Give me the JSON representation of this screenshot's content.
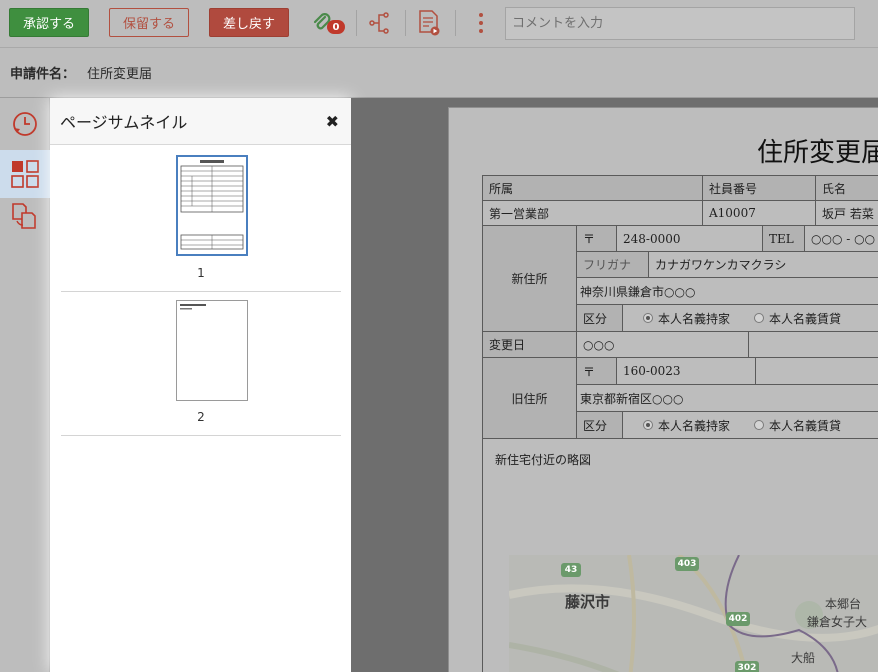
{
  "toolbar": {
    "approve_label": "承認する",
    "hold_label": "保留する",
    "return_label": "差し戻す",
    "attachment_count": "0",
    "comment_placeholder": "コメントを入力"
  },
  "subject": {
    "label": "申請件名：",
    "value": "住所変更届"
  },
  "leftnav": {
    "items": [
      "history-icon",
      "thumbnails-icon",
      "copy-icon"
    ]
  },
  "thumbnails": {
    "title": "ページサムネイル",
    "close": "✖",
    "pages": [
      {
        "number": "1"
      },
      {
        "number": "2"
      }
    ]
  },
  "document": {
    "title": "住所変更届",
    "header": {
      "dept_label": "所属",
      "empno_label": "社員番号",
      "name_label": "氏名"
    },
    "row1": {
      "dept": "第一営業部",
      "empno": "A10007",
      "name": "坂戸 若菜"
    },
    "new_address": {
      "label": "新住所",
      "zip_mark": "〒",
      "zip": "248-0000",
      "tel_label": "TEL",
      "tel": "○○○ - ○○",
      "furigana_label": "フリガナ",
      "furigana": "カナガワケンカマクラシ",
      "address": "神奈川県鎌倉市○○○",
      "kubun_label": "区分",
      "option1": "本人名義持家",
      "option2": "本人名義賃貸"
    },
    "change_date": {
      "label": "変更日",
      "value": "○○○"
    },
    "old_address": {
      "label": "旧住所",
      "zip_mark": "〒",
      "zip": "160-0023",
      "address": "東京都新宿区○○○",
      "kubun_label": "区分",
      "option1": "本人名義持家",
      "option2": "本人名義賃貸"
    },
    "map_section": {
      "label": "新住宅付近の略図",
      "labels": {
        "city": "藤沢市",
        "place1": "本郷台",
        "place2": "鎌倉女子大",
        "place3": "大船",
        "road1": "43",
        "road2": "403",
        "road3": "402",
        "road4": "302"
      }
    }
  }
}
